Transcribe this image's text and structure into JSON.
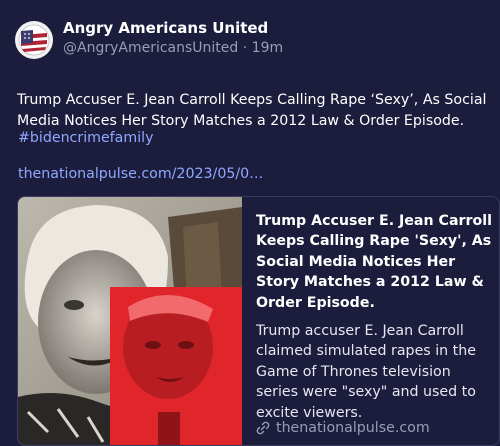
{
  "post": {
    "author_name": "Angry Americans United",
    "handle": "@AngryAmericansUnited",
    "separator": " · ",
    "time": "19m",
    "body": "Trump Accuser E. Jean Carroll Keeps Calling Rape ‘Sexy’, As Social Media Notices Her Story Matches a 2012 Law & Order Episode.",
    "hashtag": "#bidencrimefamily",
    "link": "thenationalpulse.com/2023/05/0…"
  },
  "card": {
    "title": "Trump Accuser E. Jean Carroll Keeps Calling Rape 'Sexy', As Social Media Notices Her Story Matches a 2012 Law & Order Episode.",
    "description": "Trump accuser E. Jean Carroll claimed simulated rapes in the Game of Thrones television series were \"sexy\" and used to excite viewers.",
    "domain": "thenationalpulse.com"
  },
  "colors": {
    "background": "#1c1d3c",
    "link": "#8fa7ff",
    "muted": "#9a9bb8",
    "image_overlay_red": "#e0252b"
  },
  "icons": {
    "avatar": "american-flag-avatar",
    "domain": "link-icon"
  }
}
